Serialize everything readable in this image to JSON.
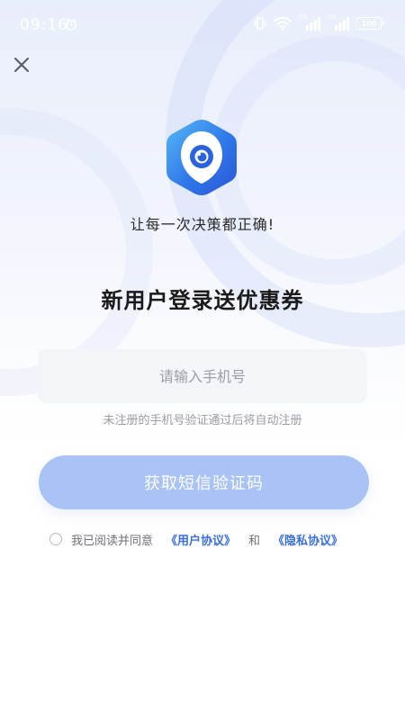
{
  "status_bar": {
    "time": "09:16",
    "network_label": "5G",
    "battery": "100"
  },
  "icons": {
    "close": "close-icon",
    "logo": "eye-hexagon-logo",
    "alarm": "alarm-icon",
    "wifi": "wifi-icon",
    "signal": "signal-icon"
  },
  "colors": {
    "brand": "#2f6ee8",
    "button": "#a9c3f6",
    "link": "#3a6fd8"
  },
  "slogan": "让每一次决策都正确!",
  "promo_title": "新用户登录送优惠券",
  "phone_input": {
    "placeholder": "请输入手机号",
    "value": ""
  },
  "hint": "未注册的手机号验证通过后将自动注册",
  "sms_button_label": "获取短信验证码",
  "agreement": {
    "prefix": "我已阅读并同意",
    "user_agreement": "《用户协议》",
    "and": "和",
    "privacy_policy": "《隐私协议》",
    "checked": false
  }
}
